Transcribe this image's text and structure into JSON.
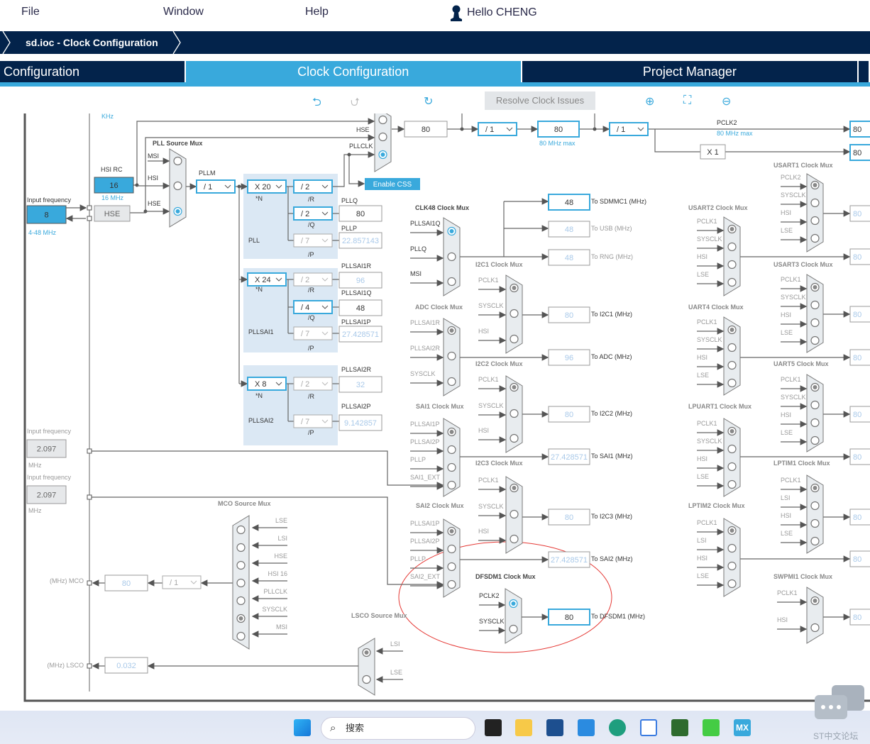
{
  "menu": {
    "items": [
      "File",
      "Window",
      "Help"
    ],
    "user": "Hello CHENG"
  },
  "breadcrumb": "sd.ioc - Clock Configuration",
  "tabs": [
    {
      "label": "Configuration"
    },
    {
      "label": "Clock Configuration",
      "active": true
    },
    {
      "label": "Project Manager"
    }
  ],
  "toolbar": {
    "resolve": "Resolve Clock Issues",
    "icons": [
      "undo-icon",
      "redo-icon",
      "reset-icon",
      "zoom-in-icon",
      "fit-icon",
      "zoom-out-icon"
    ]
  },
  "colors": {
    "brand_dark": "#03234b",
    "accent": "#39a9dc",
    "highlight_circle": "#e53935"
  },
  "diagram": {
    "khz_label": "KHz",
    "hse_input": {
      "label": "Input frequency",
      "value": "8",
      "range": "4-48 MHz"
    },
    "hsi_rc": {
      "label": "HSI RC",
      "value": "16",
      "freq": "16 MHz"
    },
    "hse_label": "HSE",
    "pll_source_mux": {
      "title": "PLL Source Mux",
      "inputs": [
        "MSI",
        "HSI",
        "HSE"
      ],
      "selected": 2
    },
    "pllm": {
      "label": "PLLM",
      "value": "/ 1"
    },
    "suffix": {
      "n": "*N",
      "r": "/R",
      "q": "/Q",
      "p": "/P"
    },
    "pll": {
      "name": "PLL",
      "n": "X 20",
      "r": "/ 2",
      "q": "/ 2",
      "p": "/ 7",
      "q_label": "PLLQ",
      "q_out": "80",
      "p_label": "PLLP",
      "p_out": "22.857143"
    },
    "pllsai1": {
      "name": "PLLSAI1",
      "n": "X 24",
      "r": "/ 2",
      "q": "/ 4",
      "p": "/ 7",
      "r_label": "PLLSAI1R",
      "r_out": "96",
      "q_label": "PLLSAI1Q",
      "q_out": "48",
      "p_label": "PLLSAI1P",
      "p_out": "27.428571"
    },
    "pllsai2": {
      "name": "PLLSAI2",
      "n": "X 8",
      "r": "/ 2",
      "p": "/ 7",
      "r_label": "PLLSAI2R",
      "r_out": "32",
      "p_label": "PLLSAI2P",
      "p_out": "9.142857"
    },
    "system_clock_mux": {
      "inputs": [
        "HSE",
        "PLLCLK"
      ],
      "selected": "PLLCLK"
    },
    "enable_css": "Enable CSS",
    "sysclk": "80",
    "ahb_prescaler": "/ 1",
    "hclk": "80",
    "hclk_max": "80 MHz max",
    "apb2_prescaler": "/ 1",
    "pclk2_label": "PCLK2",
    "pclk2_max": "80 MHz max",
    "apb2_timer_mult": "X 1",
    "pclk2_out": "80",
    "apb2_timer_out": "80",
    "clk48_outputs": [
      {
        "value": "48",
        "label": "To SDMMC1 (MHz)",
        "active": true
      },
      {
        "value": "48",
        "label": "To USB (MHz)"
      },
      {
        "value": "48",
        "label": "To RNG (MHz)"
      }
    ],
    "muxes": [
      {
        "title": "CLK48 Clock Mux",
        "inputs": [
          "PLLSAI1Q",
          "PLLQ",
          "MSI"
        ],
        "selected": 0,
        "active": true
      },
      {
        "title": "I2C1 Clock Mux",
        "inputs": [
          "PCLK1",
          "SYSCLK",
          "HSI"
        ],
        "selected": 0,
        "output": "80",
        "output_label": "To I2C1 (MHz)"
      },
      {
        "title": "ADC Clock Mux",
        "inputs": [
          "PLLSAI1R",
          "PLLSAI2R",
          "SYSCLK"
        ],
        "selected": 0,
        "output": "96",
        "output_label": "To ADC (MHz)"
      },
      {
        "title": "I2C2 Clock Mux",
        "inputs": [
          "PCLK1",
          "SYSCLK",
          "HSI"
        ],
        "selected": 0,
        "output": "80",
        "output_label": "To I2C2 (MHz)"
      },
      {
        "title": "SAI1 Clock Mux",
        "inputs": [
          "PLLSAI1P",
          "PLLSAI2P",
          "PLLP",
          "SAI1_EXT"
        ],
        "selected": 0,
        "output": "27.428571",
        "output_label": "To SAI1 (MHz)"
      },
      {
        "title": "I2C3 Clock Mux",
        "inputs": [
          "PCLK1",
          "SYSCLK",
          "HSI"
        ],
        "selected": 0,
        "output": "80",
        "output_label": "To I2C3 (MHz)"
      },
      {
        "title": "SAI2 Clock Mux",
        "inputs": [
          "PLLSAI1P",
          "PLLSAI2P",
          "PLLP",
          "SAI2_EXT"
        ],
        "selected": 0,
        "output": "27.428571",
        "output_label": "To SAI2 (MHz)"
      },
      {
        "title": "DFSDM1 Clock Mux",
        "inputs": [
          "PCLK2",
          "SYSCLK"
        ],
        "selected": 0,
        "output": "80",
        "output_label": "To DFSDM1 (MHz)",
        "active": true
      },
      {
        "title": "USART1 Clock Mux",
        "inputs": [
          "PCLK2",
          "SYSCLK",
          "HSI",
          "LSE"
        ],
        "selected": 0,
        "output": "80"
      },
      {
        "title": "USART2 Clock Mux",
        "inputs": [
          "PCLK1",
          "SYSCLK",
          "HSI",
          "LSE"
        ],
        "selected": 0,
        "output": "80"
      },
      {
        "title": "USART3 Clock Mux",
        "inputs": [
          "PCLK1",
          "SYSCLK",
          "HSI",
          "LSE"
        ],
        "selected": 0,
        "output": "80"
      },
      {
        "title": "UART4 Clock Mux",
        "inputs": [
          "PCLK1",
          "SYSCLK",
          "HSI",
          "LSE"
        ],
        "selected": 0,
        "output": "80"
      },
      {
        "title": "UART5 Clock Mux",
        "inputs": [
          "PCLK1",
          "SYSCLK",
          "HSI",
          "LSE"
        ],
        "selected": 0,
        "output": "80"
      },
      {
        "title": "LPUART1 Clock Mux",
        "inputs": [
          "PCLK1",
          "SYSCLK",
          "HSI",
          "LSE"
        ],
        "selected": 0,
        "output": "80"
      },
      {
        "title": "LPTIM1 Clock Mux",
        "inputs": [
          "PCLK1",
          "LSI",
          "HSI",
          "LSE"
        ],
        "selected": 0,
        "output": "80"
      },
      {
        "title": "LPTIM2 Clock Mux",
        "inputs": [
          "PCLK1",
          "LSI",
          "HSI",
          "LSE"
        ],
        "selected": 0,
        "output": "80"
      },
      {
        "title": "SWPMI1 Clock Mux",
        "inputs": [
          "PCLK1",
          "HSI"
        ],
        "selected": 0,
        "output": "80"
      }
    ],
    "ext_inputs": [
      {
        "label": "Input frequency",
        "value": "2.097",
        "unit": "MHz"
      },
      {
        "label": "Input frequency",
        "value": "2.097",
        "unit": "MHz"
      }
    ],
    "mco": {
      "title": "MCO Source Mux",
      "inputs": [
        "LSE",
        "LSI",
        "HSE",
        "HSI 16",
        "PLLCLK",
        "SYSCLK",
        "MSI"
      ],
      "selected": 5,
      "prescaler": "/ 1",
      "value": "80",
      "label": "(MHz) MCO"
    },
    "lsco": {
      "title": "LSCO Source Mux",
      "inputs": [
        "LSI",
        "LSE"
      ],
      "selected": 0,
      "value": "0.032",
      "label": "(MHz) LSCO"
    }
  },
  "taskbar": {
    "search": "搜索",
    "apps": [
      "start",
      "search",
      "task-view",
      "file-explorer",
      "store",
      "mail",
      "edge",
      "baidu-netdisk",
      "keil",
      "app",
      "stm32cubemx"
    ],
    "mx_label": "MX"
  },
  "watermark": "ST中文论坛"
}
